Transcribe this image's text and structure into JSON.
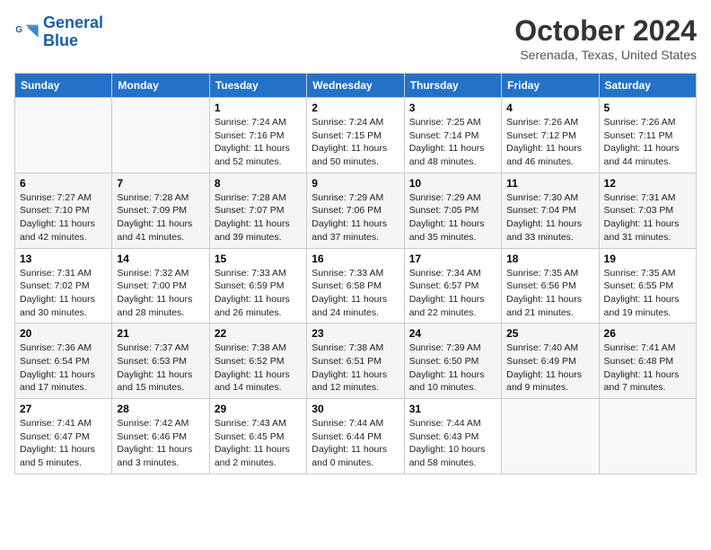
{
  "logo": {
    "line1": "General",
    "line2": "Blue"
  },
  "title": "October 2024",
  "subtitle": "Serenada, Texas, United States",
  "headers": [
    "Sunday",
    "Monday",
    "Tuesday",
    "Wednesday",
    "Thursday",
    "Friday",
    "Saturday"
  ],
  "weeks": [
    [
      {
        "day": "",
        "detail": ""
      },
      {
        "day": "",
        "detail": ""
      },
      {
        "day": "1",
        "detail": "Sunrise: 7:24 AM\nSunset: 7:16 PM\nDaylight: 11 hours and 52 minutes."
      },
      {
        "day": "2",
        "detail": "Sunrise: 7:24 AM\nSunset: 7:15 PM\nDaylight: 11 hours and 50 minutes."
      },
      {
        "day": "3",
        "detail": "Sunrise: 7:25 AM\nSunset: 7:14 PM\nDaylight: 11 hours and 48 minutes."
      },
      {
        "day": "4",
        "detail": "Sunrise: 7:26 AM\nSunset: 7:12 PM\nDaylight: 11 hours and 46 minutes."
      },
      {
        "day": "5",
        "detail": "Sunrise: 7:26 AM\nSunset: 7:11 PM\nDaylight: 11 hours and 44 minutes."
      }
    ],
    [
      {
        "day": "6",
        "detail": "Sunrise: 7:27 AM\nSunset: 7:10 PM\nDaylight: 11 hours and 42 minutes."
      },
      {
        "day": "7",
        "detail": "Sunrise: 7:28 AM\nSunset: 7:09 PM\nDaylight: 11 hours and 41 minutes."
      },
      {
        "day": "8",
        "detail": "Sunrise: 7:28 AM\nSunset: 7:07 PM\nDaylight: 11 hours and 39 minutes."
      },
      {
        "day": "9",
        "detail": "Sunrise: 7:29 AM\nSunset: 7:06 PM\nDaylight: 11 hours and 37 minutes."
      },
      {
        "day": "10",
        "detail": "Sunrise: 7:29 AM\nSunset: 7:05 PM\nDaylight: 11 hours and 35 minutes."
      },
      {
        "day": "11",
        "detail": "Sunrise: 7:30 AM\nSunset: 7:04 PM\nDaylight: 11 hours and 33 minutes."
      },
      {
        "day": "12",
        "detail": "Sunrise: 7:31 AM\nSunset: 7:03 PM\nDaylight: 11 hours and 31 minutes."
      }
    ],
    [
      {
        "day": "13",
        "detail": "Sunrise: 7:31 AM\nSunset: 7:02 PM\nDaylight: 11 hours and 30 minutes."
      },
      {
        "day": "14",
        "detail": "Sunrise: 7:32 AM\nSunset: 7:00 PM\nDaylight: 11 hours and 28 minutes."
      },
      {
        "day": "15",
        "detail": "Sunrise: 7:33 AM\nSunset: 6:59 PM\nDaylight: 11 hours and 26 minutes."
      },
      {
        "day": "16",
        "detail": "Sunrise: 7:33 AM\nSunset: 6:58 PM\nDaylight: 11 hours and 24 minutes."
      },
      {
        "day": "17",
        "detail": "Sunrise: 7:34 AM\nSunset: 6:57 PM\nDaylight: 11 hours and 22 minutes."
      },
      {
        "day": "18",
        "detail": "Sunrise: 7:35 AM\nSunset: 6:56 PM\nDaylight: 11 hours and 21 minutes."
      },
      {
        "day": "19",
        "detail": "Sunrise: 7:35 AM\nSunset: 6:55 PM\nDaylight: 11 hours and 19 minutes."
      }
    ],
    [
      {
        "day": "20",
        "detail": "Sunrise: 7:36 AM\nSunset: 6:54 PM\nDaylight: 11 hours and 17 minutes."
      },
      {
        "day": "21",
        "detail": "Sunrise: 7:37 AM\nSunset: 6:53 PM\nDaylight: 11 hours and 15 minutes."
      },
      {
        "day": "22",
        "detail": "Sunrise: 7:38 AM\nSunset: 6:52 PM\nDaylight: 11 hours and 14 minutes."
      },
      {
        "day": "23",
        "detail": "Sunrise: 7:38 AM\nSunset: 6:51 PM\nDaylight: 11 hours and 12 minutes."
      },
      {
        "day": "24",
        "detail": "Sunrise: 7:39 AM\nSunset: 6:50 PM\nDaylight: 11 hours and 10 minutes."
      },
      {
        "day": "25",
        "detail": "Sunrise: 7:40 AM\nSunset: 6:49 PM\nDaylight: 11 hours and 9 minutes."
      },
      {
        "day": "26",
        "detail": "Sunrise: 7:41 AM\nSunset: 6:48 PM\nDaylight: 11 hours and 7 minutes."
      }
    ],
    [
      {
        "day": "27",
        "detail": "Sunrise: 7:41 AM\nSunset: 6:47 PM\nDaylight: 11 hours and 5 minutes."
      },
      {
        "day": "28",
        "detail": "Sunrise: 7:42 AM\nSunset: 6:46 PM\nDaylight: 11 hours and 3 minutes."
      },
      {
        "day": "29",
        "detail": "Sunrise: 7:43 AM\nSunset: 6:45 PM\nDaylight: 11 hours and 2 minutes."
      },
      {
        "day": "30",
        "detail": "Sunrise: 7:44 AM\nSunset: 6:44 PM\nDaylight: 11 hours and 0 minutes."
      },
      {
        "day": "31",
        "detail": "Sunrise: 7:44 AM\nSunset: 6:43 PM\nDaylight: 10 hours and 58 minutes."
      },
      {
        "day": "",
        "detail": ""
      },
      {
        "day": "",
        "detail": ""
      }
    ]
  ]
}
